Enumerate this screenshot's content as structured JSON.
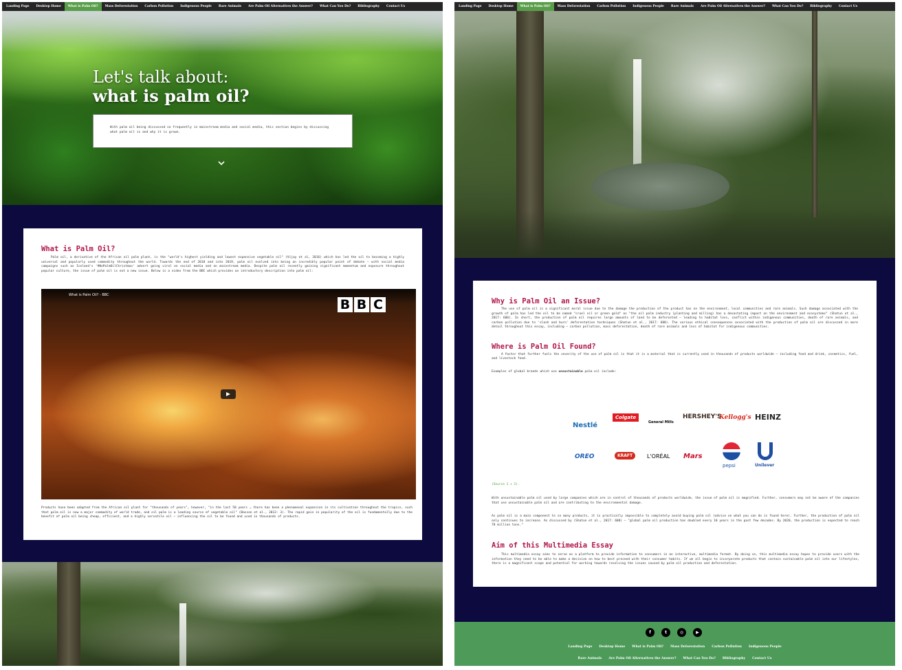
{
  "nav": {
    "items": [
      "Landing Page",
      "Desktop Home",
      "What is Palm Oil?",
      "Mass Deforestation",
      "Carbon Pollution",
      "Indigenous People",
      "Rare Animals",
      "Are Palm Oil Alternatives the Answer?",
      "What Can You Do?",
      "Bibliography",
      "Contact Us"
    ],
    "active": "What is Palm Oil?"
  },
  "hero": {
    "title_line1": "Let's talk about:",
    "title_line2": "what is palm oil?",
    "intro": "With palm oil being discussed so frequently in mainstream media and social media, this section begins by discussing what palm oil is and why it is grown."
  },
  "section1": {
    "heading": "What is Palm Oil?",
    "para1": "Palm oil, a derivative of the African oil palm plant, is the \"world's highest yielding and lowest expensive vegetable oil\" (Vijay et al, 2016) which has led the oil to becoming a highly universal and popularly used commodity throughout the world. Towards the end of 2018 and into 2019, palm oil evolved into being an incredibly popular point of debate – with social media campaigns such as Iceland's '#NoPalmOilChristmas' advert going viral on social media and on mainstream media. Despite palm oil recently gaining significant momentum and exposure throughout popular culture, the issue of palm oil is not a new issue. Below is a video from the BBC which provides an introductory description into palm oil:",
    "video_title": "What is Palm Oil? - BBC",
    "bbc_letters": [
      "B",
      "B",
      "C"
    ],
    "para2": "Products have been adapted from the African oil plant for \"thousands of years\", however, \"in the last 50 years … there has been a phenomenal expansion in its cultivation throughout the tropics, such that palm oil is now a major commodity of world trade, and oil palm is a leading source of vegetable oil\" (Basson et al., 2012: 3). The rapid gain in popularity of the oil is fundamentally due to the benefit of palm oil being cheap, efficient, and a highly versatile oil – influencing the oil to be found and used in thousands of products."
  },
  "section2": {
    "heading": "Why is Palm Oil an Issue?",
    "para": "The use of palm oil is a significant moral issue due to the damage the production of the product has on the environment, local communities and rare animals. Such damage associated with the growth of palm has led the oil to be named \"cruel oil or green gold\" as \"the oil palm industry (planting and milling) has a devastating impact on the environment and ecosystems\" (Shatun et al., 2017: 608). In short, the production of palm oil requires large amounts of land to be deforested – leading to habitat loss, conflict within indigenous communities, death of rare animals, and carbon pollution due to 'slash and burn' deforestation techniques (Shatun et al., 2017: 608). The various ethical consequences associated with the production of palm oil are discussed in more detail throughout this essay, including – carbon pollution, mass deforestation, death of rare animals and loss of habitat for indigenous communities."
  },
  "section3": {
    "heading": "Where is Palm Oil Found?",
    "para": "A factor that further fuels the severity of the use of palm oil is that it is a material that is currently used in thousands of products worldwide – including food and drink, cosmetics, fuel, and livestock feed.",
    "examples_prefix": "Examples of global brands which use ",
    "examples_bold": "unsustainable",
    "examples_suffix": " palm oil include:",
    "brands_row1": [
      "Nestlé",
      "Colgate",
      "General Mills",
      "HERSHEY'S",
      "Kellogg's",
      "HEINZ"
    ],
    "brands_row2": [
      "OREO",
      "KRAFT",
      "L'ORÉAL",
      "Mars",
      "pepsi",
      "Unilever"
    ],
    "source": "(Source 1 + 2).",
    "para2": "With unsustainable palm oil used by large companies which are in control of thousands of products worldwide, the issue of palm oil is magnified. Further, consumers may not be aware of the companies that use unsustainable palm oil and are contributing to the environmental damage.",
    "para3": "As palm oil is a main component to so many products, it is practically impossible to completely avoid buying palm oil (advice on what you can do is found here). Further, the production of palm oil only continues to increase. As discussed by (Shatun et al., 2017: 608) – \"global palm oil production has doubled every 10 years in the past few decades. By 2020, the production is expected to reach 78 million tons.\""
  },
  "section4": {
    "heading": "Aim of this Multimedia Essay",
    "para": "This multimedia essay aims to serve as a platform to provide information to consumers in an interactive, multimedia format. By doing so, this multimedia essay hopes to provide users with the information they need to be able to make a decision on how to best proceed with their consumer habits. If we all begin to incorporate products that contain sustainable palm oil into our lifestyles, there is a magnificent scope and potential for working towards resolving the issues caused by palm oil production and deforestation."
  },
  "footer": {
    "social": [
      "f",
      "t",
      "◎",
      "▶"
    ],
    "row1": [
      "Landing Page",
      "Desktop Home",
      "What is Palm Oil?",
      "Mass Deforestation",
      "Carbon Pollution",
      "Indigenous People"
    ],
    "row2": [
      "Rare Animals",
      "Are Palm Oil Alternatives the Answer?",
      "What Can You Do?",
      "Bibliography",
      "Contact Us"
    ]
  },
  "colors": {
    "nav_bg": "#262626",
    "nav_active": "#5a9e4b",
    "section_bg": "#0c0a3e",
    "heading": "#b0154b",
    "link": "#3f9a2f",
    "footer": "#4d9a59"
  },
  "icons": [
    "chevron-down-icon",
    "play-icon",
    "facebook-icon",
    "twitter-icon",
    "instagram-icon",
    "youtube-icon"
  ]
}
